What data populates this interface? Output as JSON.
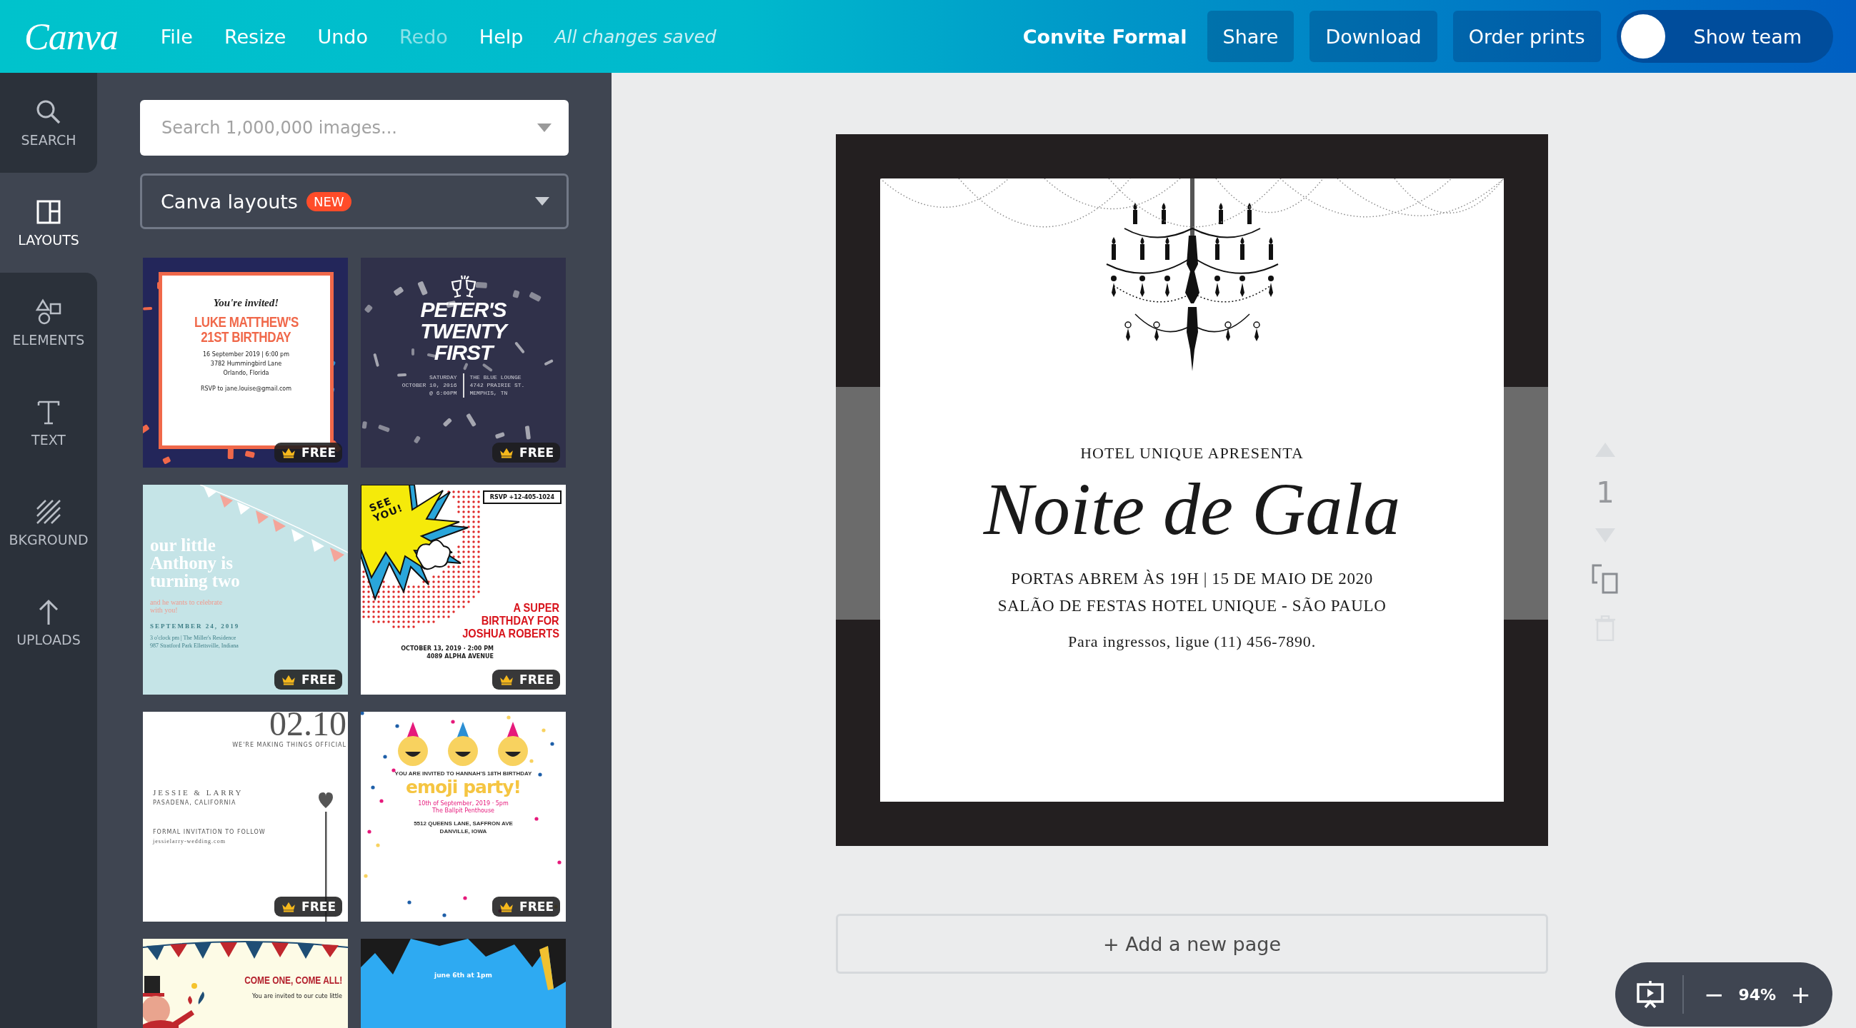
{
  "topbar": {
    "logo": "Canva",
    "menu": [
      {
        "label": "File",
        "disabled": false
      },
      {
        "label": "Resize",
        "disabled": false
      },
      {
        "label": "Undo",
        "disabled": false
      },
      {
        "label": "Redo",
        "disabled": true
      },
      {
        "label": "Help",
        "disabled": false
      }
    ],
    "save_status": "All changes saved",
    "design_title": "Convite Formal",
    "buttons": [
      "Share",
      "Download",
      "Order prints"
    ],
    "team_button": "Show team"
  },
  "rail": [
    {
      "kind": "search",
      "label": "SEARCH",
      "selected": false
    },
    {
      "kind": "layouts",
      "label": "LAYOUTS",
      "selected": true
    },
    {
      "kind": "elements",
      "label": "ELEMENTS",
      "selected": false
    },
    {
      "kind": "text",
      "label": "TEXT",
      "selected": false
    },
    {
      "kind": "background",
      "label": "BKGROUND",
      "selected": false
    },
    {
      "kind": "uploads",
      "label": "UPLOADS",
      "selected": false
    }
  ],
  "panel": {
    "search": {
      "placeholder": "Search 1,000,000 images..."
    },
    "source": {
      "value": "Canva layouts",
      "badge": "NEW"
    },
    "templates": [
      {
        "kind": "frame",
        "badge": "FREE",
        "lines": [
          "You're invited!",
          "LUKE MATTHEW'S",
          "21ST BIRTHDAY",
          "16 September 2019 | 6:00 pm",
          "3782 Hummingbird Lane",
          "Orlando, Florida",
          "RSVP to jane.louise@gmail.com"
        ]
      },
      {
        "kind": "dark",
        "badge": "FREE",
        "lines": [
          "PETER'S",
          "TWENTY",
          "FIRST",
          "SATURDAY",
          "OCTOBER 10, 2016",
          "@ 6:00PM",
          "THE BLUE LOUNGE",
          "4742 PRAIRIE ST.",
          "MEMPHIS, TN"
        ]
      },
      {
        "kind": "pastel",
        "badge": "FREE",
        "lines": [
          "our little",
          "Anthony is",
          "turning two",
          "and he wants to celebrate",
          "with you!",
          "SEPTEMBER 24, 2019",
          "3 o'clock pm | The Miller's Residence",
          "987 Stratford Park Ellettsville, Indiana"
        ]
      },
      {
        "kind": "comic",
        "badge": "FREE",
        "lines": [
          "SEE",
          "YOU!",
          "RSVP +12-405-1024",
          "A SUPER",
          "BIRTHDAY FOR",
          "JOSHUA ROBERTS",
          "OCTOBER 13, 2019 · 2:00 PM",
          "4089 ALPHA AVENUE"
        ]
      },
      {
        "kind": "minimal",
        "badge": "FREE",
        "lines": [
          "02.10",
          "WE'RE MAKING THINGS OFFICIAL",
          "JESSIE & LARRY",
          "PASADENA, CALIFORNIA",
          "FORMAL INVITATION TO FOLLOW",
          "jessielarry-wedding.com"
        ]
      },
      {
        "kind": "emoji",
        "badge": "FREE",
        "lines": [
          "YOU ARE INVITED TO HANNAH'S 18TH BIRTHDAY",
          "emoji party!",
          "10th of September, 2019 · 5pm",
          "The Ballpit Penthouse",
          "5512 QUEENS LANE, SAFFRON AVE",
          "DANVILLE, IOWA"
        ]
      },
      {
        "kind": "circus",
        "lines": [
          "COME ONE, COME ALL!",
          "You are invited to our cute little"
        ]
      },
      {
        "kind": "burst",
        "lines": [
          "june 6th at 1pm"
        ]
      }
    ]
  },
  "design": {
    "lines": [
      {
        "kind": "kicker",
        "text": "HOTEL UNIQUE APRESENTA"
      },
      {
        "kind": "title",
        "text": "Noite de Gala"
      },
      {
        "kind": "detail",
        "text": "PORTAS ABREM ÀS 19H | 15 DE MAIO DE 2020"
      },
      {
        "kind": "detail",
        "text": "SALÃO DE FESTAS HOTEL UNIQUE - SÃO PAULO"
      },
      {
        "kind": "note",
        "text": "Para ingressos, ligue (11) 456-7890."
      }
    ]
  },
  "page_tools": [
    {
      "kind": "up",
      "disabled": true
    },
    {
      "kind": "number",
      "text": "1"
    },
    {
      "kind": "down",
      "disabled": true
    },
    {
      "kind": "copy",
      "disabled": false
    },
    {
      "kind": "delete",
      "disabled": true
    }
  ],
  "add_page": "+ Add a new page",
  "zoom": {
    "minus": "−",
    "value": "94%",
    "plus": "+"
  }
}
